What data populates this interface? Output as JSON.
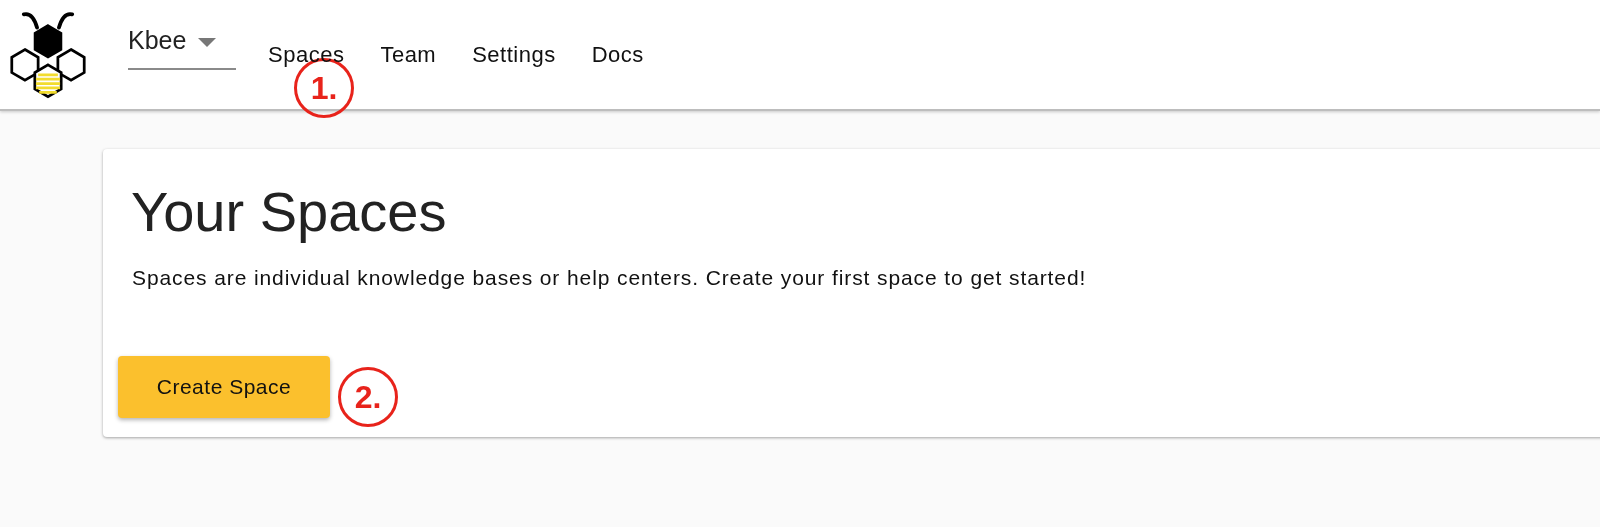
{
  "header": {
    "space_selector": {
      "value": "Kbee"
    },
    "nav": [
      {
        "label": "Spaces"
      },
      {
        "label": "Team"
      },
      {
        "label": "Settings"
      },
      {
        "label": "Docs"
      }
    ]
  },
  "card": {
    "title": "Your Spaces",
    "description": "Spaces are individual knowledge bases or help centers. Create your first space to get started!",
    "button": "Create Space"
  },
  "annotations": [
    {
      "label": "1."
    },
    {
      "label": "2."
    }
  ]
}
